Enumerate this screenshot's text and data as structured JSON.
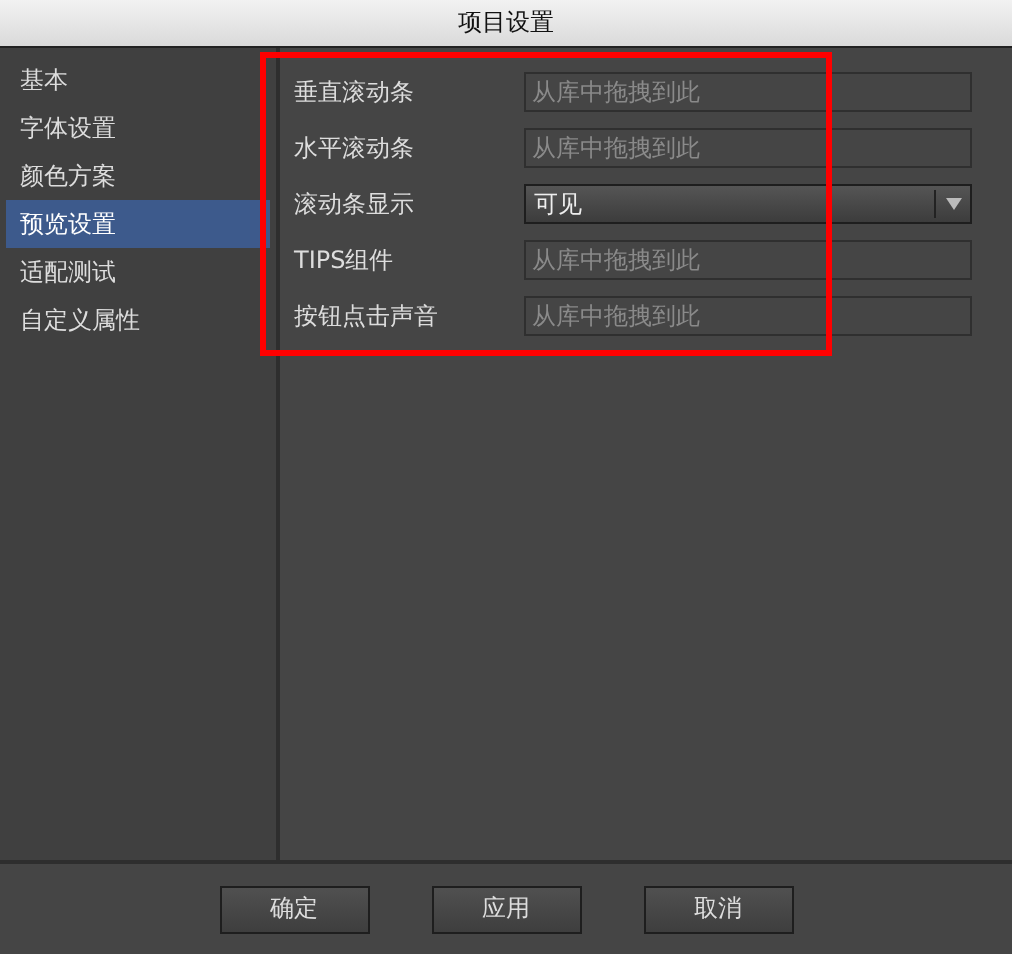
{
  "window": {
    "title": "项目设置"
  },
  "sidebar": {
    "items": [
      {
        "label": "基本",
        "selected": false
      },
      {
        "label": "字体设置",
        "selected": false
      },
      {
        "label": "颜色方案",
        "selected": false
      },
      {
        "label": "预览设置",
        "selected": true
      },
      {
        "label": "适配测试",
        "selected": false
      },
      {
        "label": "自定义属性",
        "selected": false
      }
    ]
  },
  "settings": [
    {
      "label": "垂直滚动条",
      "kind": "input",
      "placeholder": "从库中拖拽到此"
    },
    {
      "label": "水平滚动条",
      "kind": "input",
      "placeholder": "从库中拖拽到此"
    },
    {
      "label": "滚动条显示",
      "kind": "select",
      "value": "可见"
    },
    {
      "label": "TIPS组件",
      "kind": "input",
      "placeholder": "从库中拖拽到此"
    },
    {
      "label": "按钮点击声音",
      "kind": "input",
      "placeholder": "从库中拖拽到此"
    }
  ],
  "buttons": [
    "确定",
    "应用",
    "取消"
  ]
}
